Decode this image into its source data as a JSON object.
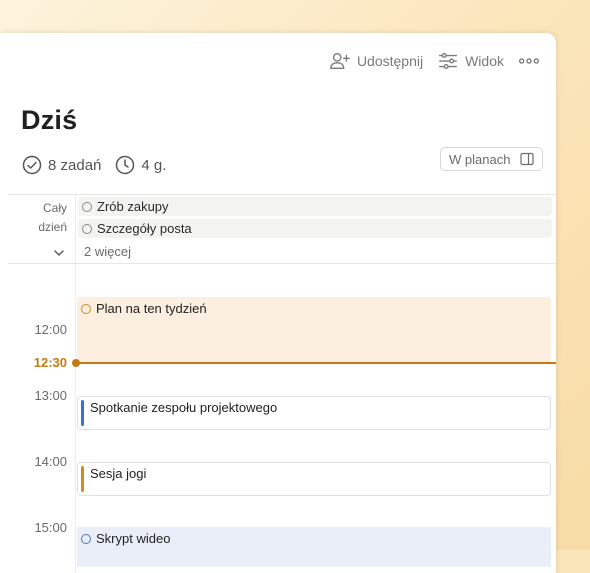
{
  "toolbar": {
    "share_label": "Udostępnij",
    "view_label": "Widok",
    "more_icon": "more-icon"
  },
  "header": {
    "title": "Dziś",
    "tasks_count": "8 zadań",
    "hours": "4 g.",
    "plans_button": "W planach"
  },
  "allday": {
    "label_line1": "Cały",
    "label_line2": "dzień",
    "items": [
      "Zrób zakupy",
      "Szczegóły posta"
    ],
    "more_label": "2 więcej"
  },
  "timeline": {
    "times": [
      "12:00",
      "12:30",
      "13:00",
      "14:00",
      "15:00"
    ],
    "current_time": "12:30",
    "events": [
      {
        "title": "Plan na ten tydzień",
        "color": "#d08a2a"
      },
      {
        "title": "Spotkanie zespołu projektowego",
        "color": "#3b6fd0"
      },
      {
        "title": "Sesja jogi",
        "color": "#d08a2a"
      },
      {
        "title": "Skrypt wideo",
        "color": "#4c74c3"
      }
    ]
  },
  "colors": {
    "accent": "#c47a14",
    "background": "#fbe6bd"
  }
}
